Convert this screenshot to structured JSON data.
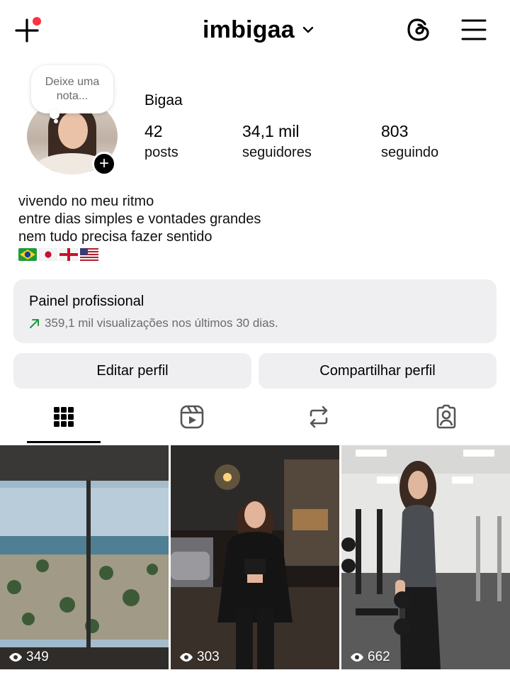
{
  "header": {
    "username": "imbigaa",
    "add_icon": "plus-icon",
    "threads_icon": "threads-icon",
    "menu_icon": "hamburger-menu-icon",
    "notification_dot_color": "#ff3040"
  },
  "profile": {
    "note_placeholder": "Deixe uma nota...",
    "display_name": "Bigaa",
    "stats": [
      {
        "value": "42",
        "label": "posts"
      },
      {
        "value": "34,1 mil",
        "label": "seguidores"
      },
      {
        "value": "803",
        "label": "seguindo"
      }
    ],
    "bio": [
      "vivendo no meu ritmo",
      "entre dias simples e vontades grandes",
      "nem tudo precisa fazer sentido"
    ],
    "flags": [
      "brazil-flag-icon",
      "japan-flag-icon",
      "england-flag-icon",
      "usa-flag-icon"
    ]
  },
  "professional_panel": {
    "title": "Painel profissional",
    "subtitle": "359,1 mil visualizações nos últimos 30 dias."
  },
  "actions": {
    "edit_profile": "Editar perfil",
    "share_profile": "Compartilhar perfil"
  },
  "tabs": [
    {
      "name": "grid-icon",
      "active": true
    },
    {
      "name": "reels-icon",
      "active": false
    },
    {
      "name": "reposts-icon",
      "active": false
    },
    {
      "name": "tagged-icon",
      "active": false
    }
  ],
  "posts": [
    {
      "views": "349",
      "subject": "beach view through window"
    },
    {
      "views": "303",
      "subject": "woman on street at night"
    },
    {
      "views": "662",
      "subject": "woman at gym with dumbbell"
    }
  ]
}
